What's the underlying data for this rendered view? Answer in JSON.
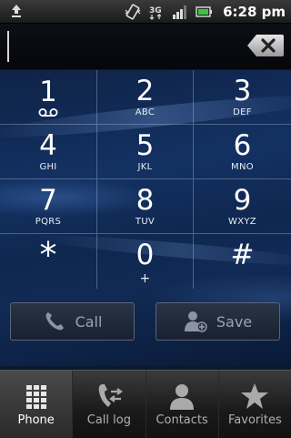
{
  "status_bar": {
    "time": "6:28 pm",
    "left_icon": "upload-notification-icon",
    "icons": [
      "vibrate-icon",
      "data-3g-icon",
      "signal-bars-icon",
      "battery-icon"
    ]
  },
  "dialer": {
    "number": "",
    "keys": [
      {
        "digit": "1",
        "letters": "",
        "extra": "voicemail-icon"
      },
      {
        "digit": "2",
        "letters": "ABC"
      },
      {
        "digit": "3",
        "letters": "DEF"
      },
      {
        "digit": "4",
        "letters": "GHI"
      },
      {
        "digit": "5",
        "letters": "JKL"
      },
      {
        "digit": "6",
        "letters": "MNO"
      },
      {
        "digit": "7",
        "letters": "PQRS"
      },
      {
        "digit": "8",
        "letters": "TUV"
      },
      {
        "digit": "9",
        "letters": "WXYZ"
      },
      {
        "digit": "*",
        "letters": ""
      },
      {
        "digit": "0",
        "letters": "+"
      },
      {
        "digit": "#",
        "letters": ""
      }
    ]
  },
  "actions": {
    "call_label": "Call",
    "save_label": "Save"
  },
  "tabs": [
    {
      "label": "Phone",
      "icon": "keypad-grid-icon",
      "active": true
    },
    {
      "label": "Call log",
      "icon": "call-log-icon",
      "active": false
    },
    {
      "label": "Contacts",
      "icon": "contacts-person-icon",
      "active": false
    },
    {
      "label": "Favorites",
      "icon": "star-icon",
      "active": false
    }
  ],
  "colors": {
    "keypad_background": "#133163",
    "status_bar": "#2a2a2a",
    "tab_active": "#4a4a4a"
  }
}
